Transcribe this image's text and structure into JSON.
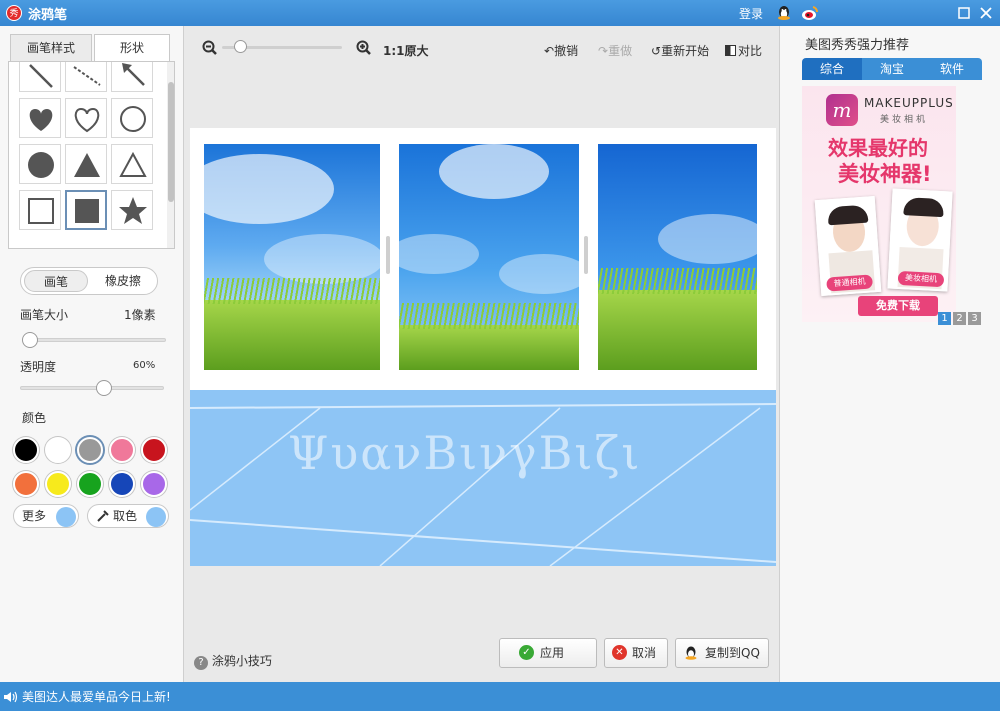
{
  "window": {
    "logo_char": "秀",
    "title": "涂鸦笔",
    "login": "登录"
  },
  "left": {
    "tabs": [
      "画笔样式",
      "形状"
    ],
    "shapes": [
      "line",
      "dashed-line",
      "arrow",
      "heart-filled",
      "heart-outline",
      "circle-outline",
      "circle-filled",
      "triangle-filled",
      "triangle-outline",
      "square-outline",
      "square-filled",
      "star-filled"
    ],
    "mode_toggle": {
      "pen": "画笔",
      "eraser": "橡皮擦"
    },
    "brush_size": {
      "label": "画笔大小",
      "value": "1像素"
    },
    "opacity": {
      "label": "透明度",
      "value": "60%"
    },
    "color_label": "颜色",
    "colors": [
      "#000000",
      "#ffffff",
      "#999999",
      "#f0789a",
      "#c8141e",
      "#f2703c",
      "#f7ea1c",
      "#17a31e",
      "#1646b8",
      "#a868e8"
    ],
    "more_label": "更多",
    "pick_label": "取色"
  },
  "toolbar": {
    "zoom_text": "1:1原大",
    "undo": "撤销",
    "redo": "重做",
    "restart": "重新开始",
    "compare": "对比"
  },
  "canvas": {
    "watermark": "ΨυανΒινγΒιζι"
  },
  "bottom": {
    "tips": "涂鸦小技巧",
    "apply": "应用",
    "cancel": "取消",
    "copy_qq": "复制到QQ"
  },
  "right": {
    "title": "美图秀秀强力推荐",
    "tabs": [
      "综合",
      "淘宝",
      "软件"
    ],
    "ad": {
      "brand": "MAKEUPPLUS",
      "brand_sub": "美妆相机",
      "headline1": "效果最好的",
      "headline2": "美妆神器!",
      "label_left": "普通相机",
      "label_right": "美妆相机",
      "download": "免费下载"
    },
    "pages": [
      "1",
      "2",
      "3"
    ]
  },
  "status": {
    "message": "美图达人最爱单品今日上新!"
  }
}
